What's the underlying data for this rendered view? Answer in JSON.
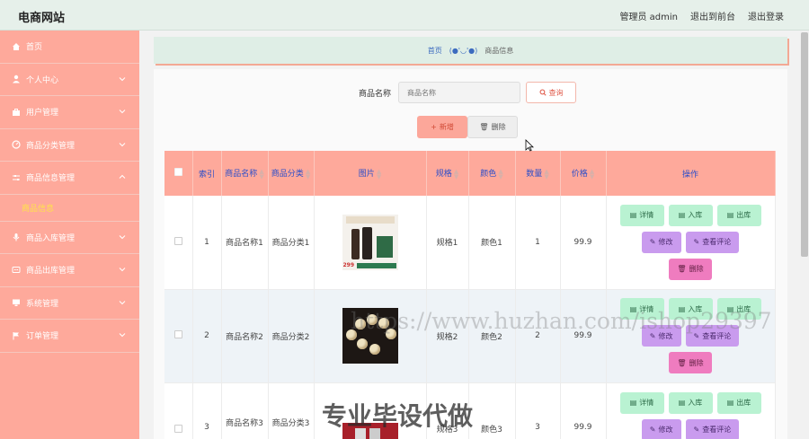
{
  "header": {
    "brand": "电商网站",
    "admin": "管理员 admin",
    "to_front": "退出到前台",
    "logout": "退出登录"
  },
  "sidebar": {
    "items": [
      {
        "label": "首页",
        "icon": "home-icon"
      },
      {
        "label": "个人中心",
        "icon": "user-icon"
      },
      {
        "label": "用户管理",
        "icon": "briefcase-icon"
      },
      {
        "label": "商品分类管理",
        "icon": "dashboard-icon"
      },
      {
        "label": "商品信息管理",
        "icon": "sliders-icon"
      },
      {
        "label": "商品入库管理",
        "icon": "mic-icon"
      },
      {
        "label": "商品出库管理",
        "icon": "chat-icon"
      },
      {
        "label": "系统管理",
        "icon": "computer-icon"
      },
      {
        "label": "订单管理",
        "icon": "flag-icon"
      }
    ],
    "active_sub": "商品信息"
  },
  "breadcrumb": {
    "home": "首页",
    "face": "(●'◡'●)",
    "current": "商品信息"
  },
  "search": {
    "label": "商品名称",
    "placeholder": "商品名称",
    "query_label": "查询"
  },
  "toolbar": {
    "add_label": "新增",
    "delete_label": "删除"
  },
  "table": {
    "columns": [
      "索引",
      "商品名称",
      "商品分类",
      "图片",
      "规格",
      "颜色",
      "数量",
      "价格",
      "操作"
    ],
    "rows": [
      {
        "index": "1",
        "name": "商品名称1",
        "category": "商品分类1",
        "spec": "规格1",
        "color": "颜色1",
        "qty": "1",
        "price": "99.9"
      },
      {
        "index": "2",
        "name": "商品名称2",
        "category": "商品分类2",
        "spec": "规格2",
        "color": "颜色2",
        "qty": "2",
        "price": "99.9"
      },
      {
        "index": "3",
        "name": "商品名称3",
        "category": "商品分类3",
        "spec": "规格3",
        "color": "颜色3",
        "qty": "3",
        "price": "99.9"
      }
    ],
    "ops": {
      "detail": "详情",
      "in_stock": "入库",
      "out_stock": "出库",
      "edit": "修改",
      "comments": "查看评论",
      "delete": "删除"
    }
  },
  "image_text": {
    "r1_price": "299"
  },
  "watermarks": {
    "url": "https://www.huzhan.com/ishop29397",
    "caption": "专业毕设代做"
  }
}
